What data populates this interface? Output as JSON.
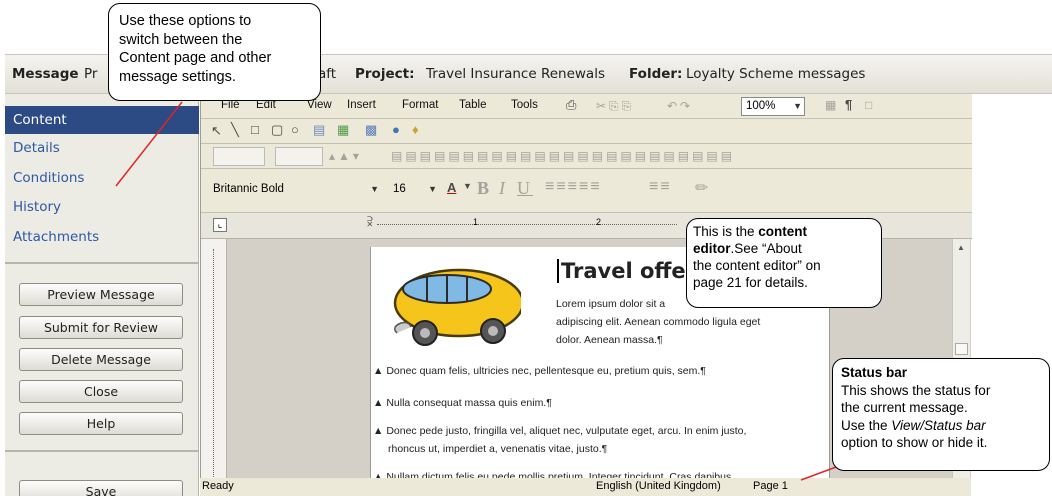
{
  "header": {
    "message_label": "Message",
    "message_prefix": "Pr",
    "message_suffix": "aft",
    "project_label": "Project:",
    "project_value": "Travel Insurance Renewals",
    "folder_label": "Folder:",
    "folder_value": "Loyalty Scheme messages"
  },
  "sidebar": {
    "nav": [
      {
        "label": "Content",
        "active": true
      },
      {
        "label": "Details"
      },
      {
        "label": "Conditions"
      },
      {
        "label": "History"
      },
      {
        "label": "Attachments"
      }
    ],
    "buttons": {
      "preview": "Preview Message",
      "submit": "Submit for Review",
      "delete": "Delete Message",
      "close": "Close",
      "help": "Help",
      "save": "Save"
    }
  },
  "editor": {
    "menu": [
      "File",
      "Edit",
      "View",
      "Insert",
      "Format",
      "Table",
      "Tools"
    ],
    "zoom": "100%",
    "font_name": "Britannic Bold",
    "font_size": "16",
    "ruler_marks": [
      "1",
      "2"
    ],
    "document": {
      "title": "Travel offer",
      "intro_lines": [
        "Lorem ipsum dolor sit a",
        "adipiscing elit. Aenean commodo ligula eget",
        "dolor. Aenean massa.¶"
      ],
      "bullets": [
        [
          "Donec quam felis, ultricies nec, pellentesque eu, pretium quis, sem.¶"
        ],
        [
          "Nulla consequat massa quis enim.¶"
        ],
        [
          "Donec pede justo, fringilla vel, aliquet nec, vulputate eget, arcu. In enim justo,",
          "rhoncus ut, imperdiet a, venenatis vitae, justo.¶"
        ],
        [
          "Nullam dictum felis eu pede mollis pretium. Integer tincidunt. Cras dapibus."
        ]
      ]
    }
  },
  "statusbar": {
    "status": "Ready",
    "language": "English (United Kingdom)",
    "page": "Page 1"
  },
  "callouts": {
    "options": [
      "Use these options to",
      "switch between the",
      "Content page and other",
      "message settings."
    ],
    "editor": {
      "line1": "This is the ",
      "line1_bold": "content",
      "line2_bold": "editor",
      "line2": ".See “About",
      "line3": "the content editor” on",
      "line4": "page 21 for details."
    },
    "statusbar": {
      "title": "Status bar",
      "line1": "This shows the status for",
      "line2": "the current message.",
      "line3_pre": "Use the ",
      "line3_italic": "View/Status bar",
      "line4": "option to show or hide it."
    }
  },
  "colors": {
    "active_nav_bg": "#2c4a84",
    "nav_link": "#2e58a4",
    "pointer_line": "#e0252a"
  }
}
